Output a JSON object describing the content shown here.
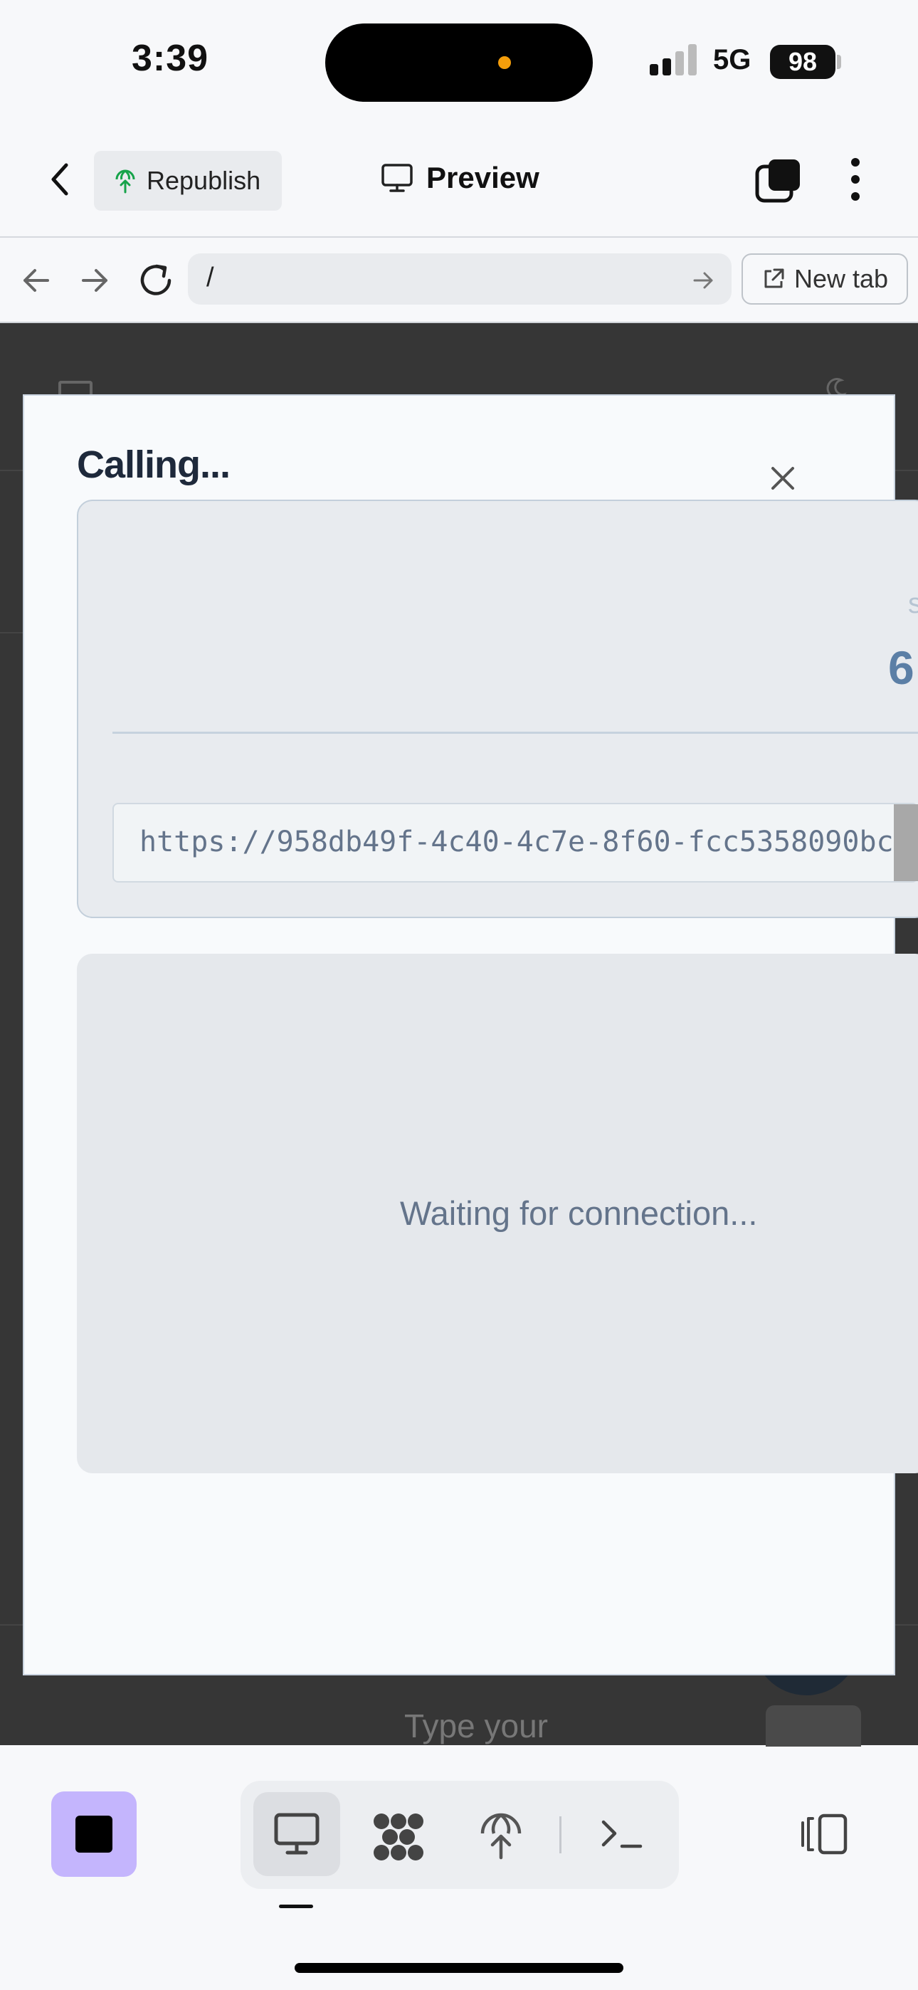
{
  "status_bar": {
    "time": "3:39",
    "network": "5G",
    "battery": "98"
  },
  "header": {
    "republish_label": "Republish",
    "preview_label": "Preview"
  },
  "browser": {
    "url": "/",
    "new_tab_label": "New tab"
  },
  "background": {
    "input_placeholder": "Type your"
  },
  "modal": {
    "title": "Calling...",
    "clipped_digit": "6",
    "clipped_char": "s",
    "url": "https://958db49f-4c40-4c7e-8f60-fcc5358090bc",
    "waiting_text": "Waiting for connection..."
  },
  "colors": {
    "accent_purple": "#c4b5fd",
    "backdrop": "#363636",
    "modal_bg": "#f8fafc",
    "muted_text": "#64748b"
  },
  "icons": [
    "back-arrow-icon",
    "republish-globe-icon",
    "monitor-icon",
    "layers-icon",
    "more-vertical-icon",
    "arrow-left-icon",
    "arrow-right-icon",
    "reload-icon",
    "go-arrow-icon",
    "external-link-icon",
    "close-icon",
    "stop-icon",
    "desktop-icon",
    "nodes-icon",
    "deploy-globe-icon",
    "terminal-icon",
    "panel-toggle-icon"
  ]
}
